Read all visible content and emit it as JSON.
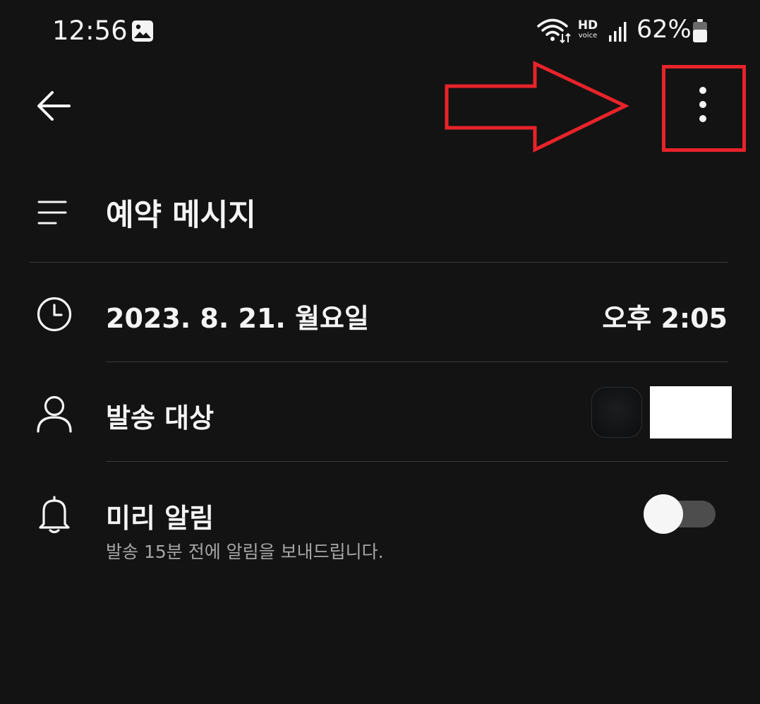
{
  "status_bar": {
    "time": "12:56",
    "battery_percent": "62%",
    "network_badge": "HD",
    "network_badge_sub": "voice",
    "battery_level": 0.62
  },
  "app_bar": {
    "back_icon": "arrow-left-icon",
    "more_icon": "more-vert-icon"
  },
  "annotation": {
    "color": "#e8232a"
  },
  "title": "예약 메시지",
  "schedule": {
    "date": "2023. 8. 21. 월요일",
    "time": "오후 2:05"
  },
  "recipient": {
    "label": "발송 대상"
  },
  "reminder": {
    "label": "미리 알림",
    "description": "발송 15분 전에 알림을 보내드립니다.",
    "enabled": false
  }
}
